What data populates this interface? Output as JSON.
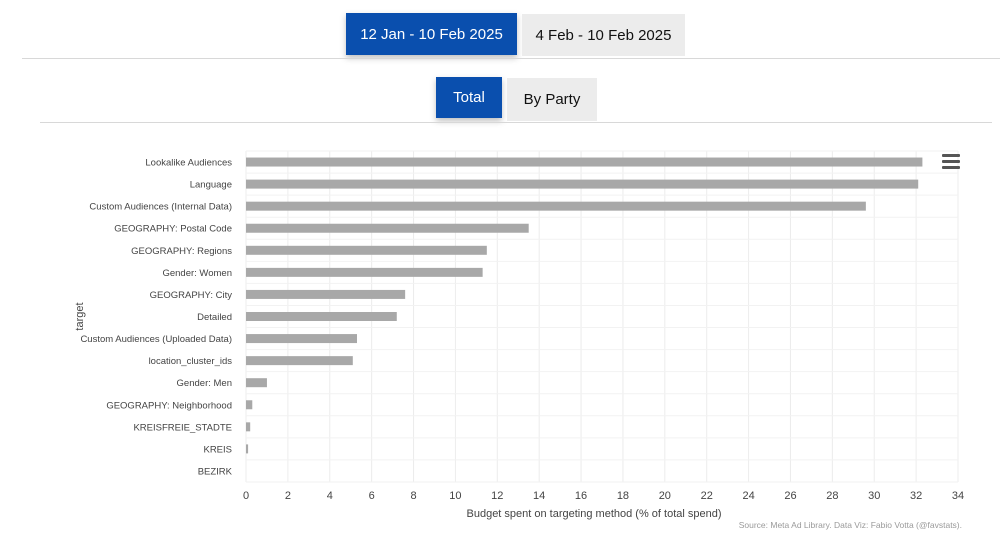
{
  "period_tabs": [
    {
      "label": "12 Jan - 10 Feb 2025",
      "active": true
    },
    {
      "label": "4 Feb - 10 Feb 2025",
      "active": false
    }
  ],
  "view_tabs": [
    {
      "label": "Total",
      "active": true
    },
    {
      "label": "By Party",
      "active": false
    }
  ],
  "source": "Source: Meta Ad Library. Data Viz: Fabio Votta (@favstats).",
  "chart_data": {
    "type": "bar",
    "orientation": "horizontal",
    "title": "",
    "xlabel": "Budget spent on targeting method (% of total spend)",
    "ylabel": "target",
    "xlim": [
      0,
      34
    ],
    "xticks": [
      0,
      2,
      4,
      6,
      8,
      10,
      12,
      14,
      16,
      18,
      20,
      22,
      24,
      26,
      28,
      30,
      32,
      34
    ],
    "grid": true,
    "bar_color": "#a8a8a8",
    "categories": [
      "Lookalike Audiences",
      "Language",
      "Custom Audiences (Internal Data)",
      "GEOGRAPHY: Postal Code",
      "GEOGRAPHY: Regions",
      "Gender: Women",
      "GEOGRAPHY: City",
      "Detailed",
      "Custom Audiences (Uploaded Data)",
      "location_cluster_ids",
      "Gender: Men",
      "GEOGRAPHY: Neighborhood",
      "KREISFREIE_STADTE",
      "KREIS",
      "BEZIRK"
    ],
    "values": [
      32.3,
      32.1,
      29.6,
      13.5,
      11.5,
      11.3,
      7.6,
      7.2,
      5.3,
      5.1,
      1.0,
      0.3,
      0.2,
      0.1,
      0.0
    ]
  }
}
